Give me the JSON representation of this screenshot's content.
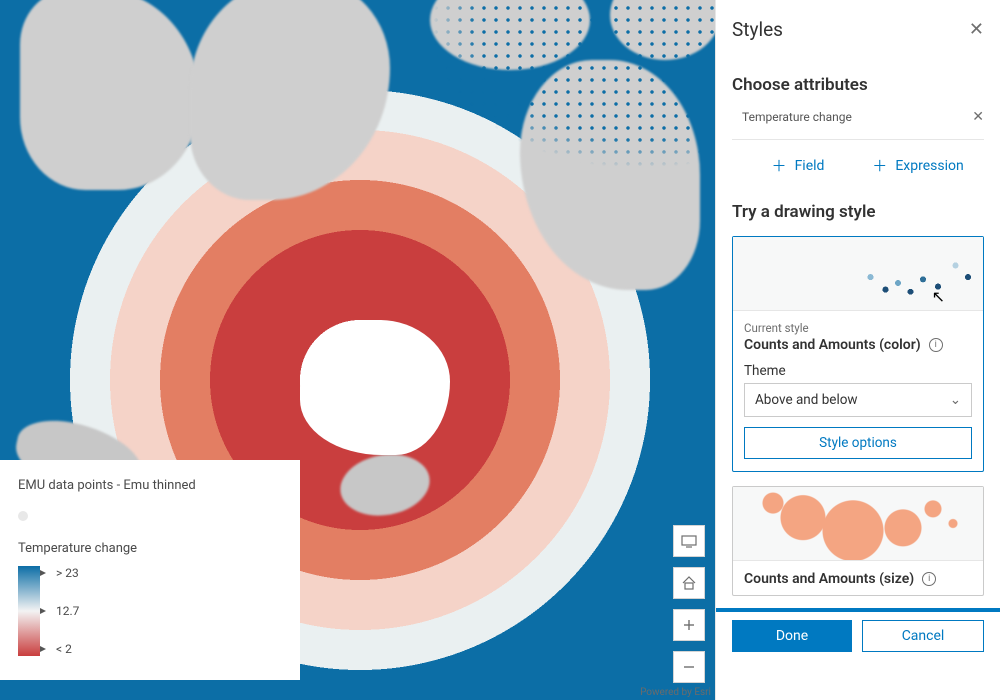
{
  "attribution": "Powered by Esri",
  "legend": {
    "layer_title": "EMU data points - Emu thinned",
    "attribute": "Temperature change",
    "ramp": {
      "high": "> 23",
      "mid": "12.7",
      "low": "< 2"
    }
  },
  "panel": {
    "title": "Styles",
    "choose_attributes": "Choose attributes",
    "selected_attribute": "Temperature change",
    "add_field": "Field",
    "add_expression": "Expression",
    "drawing_title": "Try a drawing style",
    "card1": {
      "current_style_label": "Current style",
      "name": "Counts and Amounts (color)",
      "theme_label": "Theme",
      "theme_value": "Above and below",
      "options_label": "Style options"
    },
    "card2": {
      "name": "Counts and Amounts (size)"
    },
    "done": "Done",
    "cancel": "Cancel"
  }
}
